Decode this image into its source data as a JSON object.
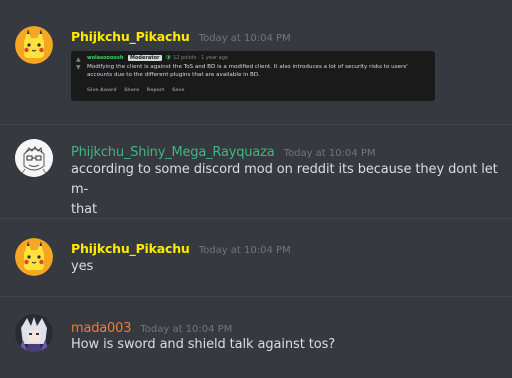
{
  "colors": {
    "background": "#36393f",
    "username_yellow": "#ffea00",
    "username_green": "#43b581",
    "username_orange": "#f47b33",
    "timestamp": "#72767d",
    "text": "#dcddde"
  },
  "messages": [
    {
      "username": "Phijkchu_Pikachu",
      "timestamp": "Today at 10:04 PM",
      "avatar": "pikachu-avatar",
      "embed": {
        "author": "wolasoooosh",
        "badge": "Moderator",
        "shield": "🛡",
        "points": "12 points · 1 year ago",
        "text": "Modifying the client is against the ToS and BD is a modified client. It also introduces a lot of security risks to users' accounts due to the different plugins that are available in BD.",
        "actions": [
          "Give Award",
          "Share",
          "Report",
          "Save"
        ]
      }
    },
    {
      "username": "Phijkchu_Shiny_Mega_Rayquaza",
      "timestamp": "Today at 10:04 PM",
      "avatar": "sketch-face-avatar",
      "lines": [
        "according to some discord mod on reddit its because they dont let m-",
        "that"
      ]
    },
    {
      "username": "Phijkchu_Pikachu",
      "timestamp": "Today at 10:04 PM",
      "avatar": "pikachu-avatar",
      "lines": [
        "yes"
      ]
    },
    {
      "username": "mada003",
      "timestamp": "Today at 10:04 PM",
      "avatar": "anime-character-avatar",
      "lines": [
        "How is sword and shield talk against tos?"
      ]
    }
  ]
}
